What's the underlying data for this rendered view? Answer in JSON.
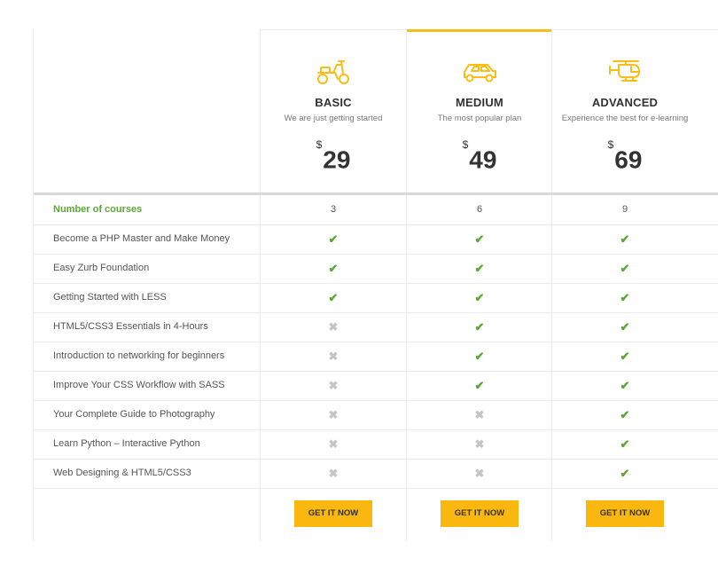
{
  "plans": [
    {
      "name": "BASIC",
      "subtitle": "We are just getting started",
      "currency": "$",
      "price": "29",
      "button": "GET IT NOW",
      "icon": "scooter-icon"
    },
    {
      "name": "MEDIUM",
      "subtitle": "The most popular plan",
      "currency": "$",
      "price": "49",
      "button": "GET IT NOW",
      "icon": "car-icon"
    },
    {
      "name": "ADVANCED",
      "subtitle": "Experience the best for e-learning",
      "currency": "$",
      "price": "69",
      "button": "GET IT NOW",
      "icon": "helicopter-icon"
    }
  ],
  "features": [
    {
      "label": "Number of courses",
      "values": [
        "3",
        "6",
        "9"
      ]
    },
    {
      "label": "Become a PHP Master and Make Money",
      "values": [
        true,
        true,
        true
      ]
    },
    {
      "label": "Easy Zurb Foundation",
      "values": [
        true,
        true,
        true
      ]
    },
    {
      "label": "Getting Started with LESS",
      "values": [
        true,
        true,
        true
      ]
    },
    {
      "label": "HTML5/CSS3 Essentials in 4-Hours",
      "values": [
        false,
        true,
        true
      ]
    },
    {
      "label": "Introduction to networking for beginners",
      "values": [
        false,
        true,
        true
      ]
    },
    {
      "label": "Improve Your CSS Workflow with SASS",
      "values": [
        false,
        true,
        true
      ]
    },
    {
      "label": "Your Complete Guide to Photography",
      "values": [
        false,
        false,
        true
      ]
    },
    {
      "label": "Learn Python – Interactive Python",
      "values": [
        false,
        false,
        true
      ]
    },
    {
      "label": "Web Designing & HTML5/CSS3",
      "values": [
        false,
        false,
        true
      ]
    }
  ],
  "colors": {
    "accent": "#f9bd15",
    "check": "#5aa732",
    "cross": "#c5c5c5"
  }
}
